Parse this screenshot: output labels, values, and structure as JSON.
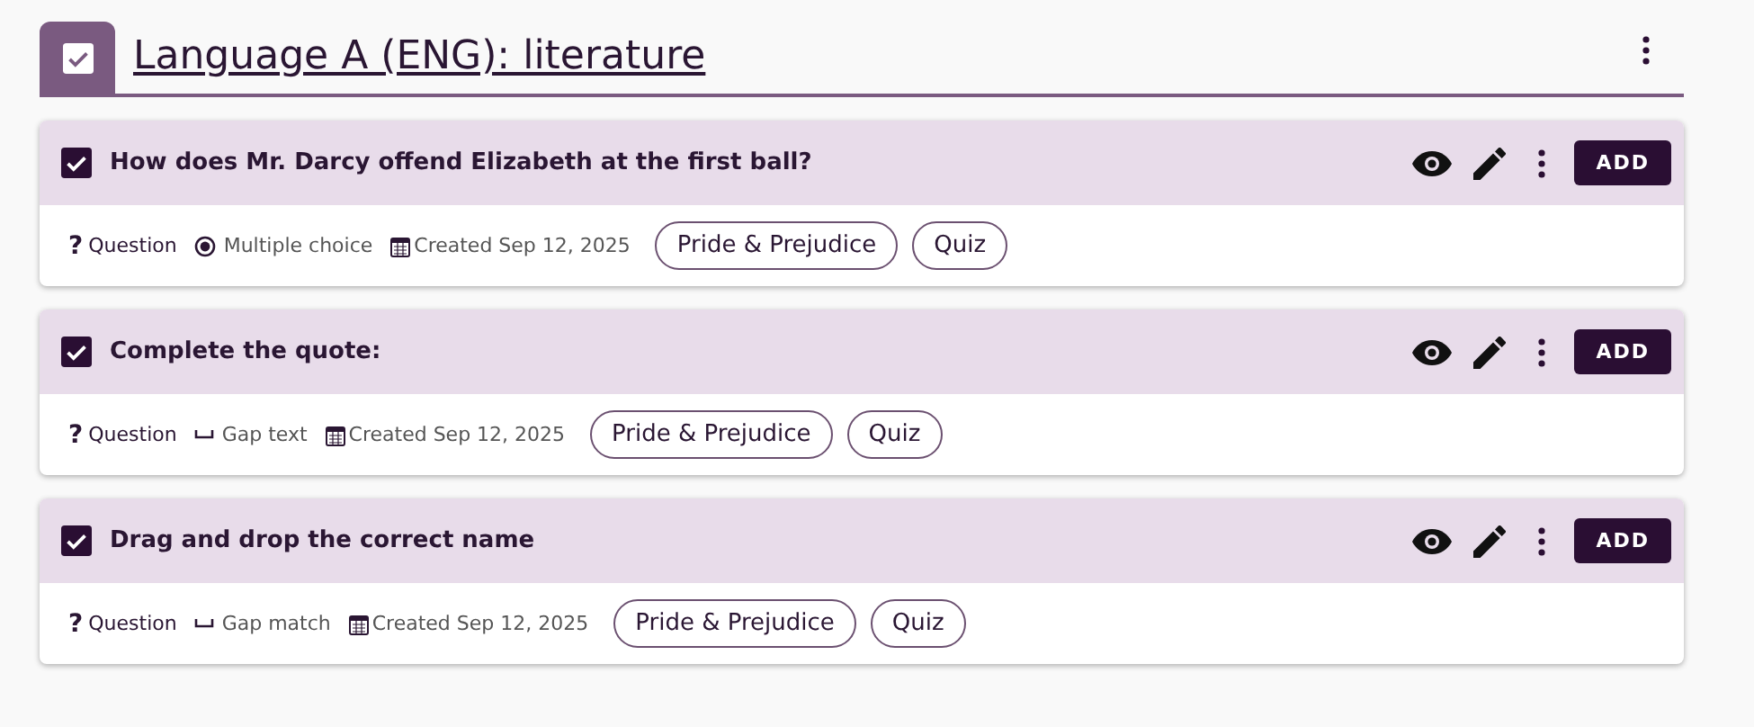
{
  "section": {
    "title": "Language A (ENG): literature",
    "checked": true
  },
  "items": [
    {
      "title": "How does Mr. Darcy offend Elizabeth at the first ball?",
      "checked": true,
      "category_mark": "?",
      "category": "Question",
      "kind": "choice",
      "type": "Multiple choice",
      "created": "Created Sep 12, 2025",
      "tags": [
        "Pride & Prejudice",
        "Quiz"
      ],
      "action": "ADD"
    },
    {
      "title": "Complete the quote:",
      "checked": true,
      "category_mark": "?",
      "category": "Question",
      "kind": "gap",
      "type": "Gap text",
      "created": "Created Sep 12, 2025",
      "tags": [
        "Pride & Prejudice",
        "Quiz"
      ],
      "action": "ADD"
    },
    {
      "title": "Drag and drop the correct name",
      "checked": true,
      "category_mark": "?",
      "category": "Question",
      "kind": "gap",
      "type": "Gap match",
      "created": "Created Sep 12, 2025",
      "tags": [
        "Pride & Prejudice",
        "Quiz"
      ],
      "action": "ADD"
    }
  ]
}
